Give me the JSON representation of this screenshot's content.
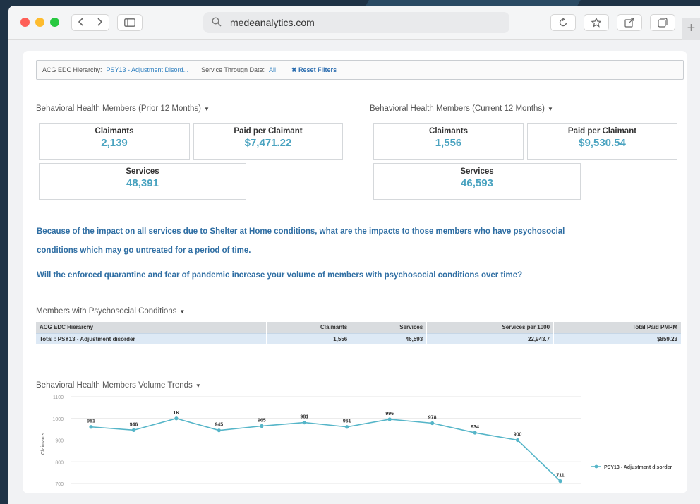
{
  "browser": {
    "url": "medeanalytics.com"
  },
  "filters": {
    "hierarchy_label": "ACG EDC Hierarchy:",
    "hierarchy_value": "PSY13 - Adjustment Disord...",
    "date_label": "Service Througn Date:",
    "date_value": "All",
    "reset_label": "Reset Filters"
  },
  "prior": {
    "title": "Behavioral Health Members (Prior 12 Months)",
    "claimants_label": "Claimants",
    "claimants_value": "2,139",
    "paid_label": "Paid per Claimant",
    "paid_value": "$7,471.22",
    "services_label": "Services",
    "services_value": "48,391"
  },
  "current": {
    "title": "Behavioral Health Members (Current 12 Months)",
    "claimants_label": "Claimants",
    "claimants_value": "1,556",
    "paid_label": "Paid per Claimant",
    "paid_value": "$9,530.54",
    "services_label": "Services",
    "services_value": "46,593"
  },
  "questions": {
    "q1_line1": "Because of the impact on all services due to Shelter at Home conditions, what are the impacts to those members who have psychosocial",
    "q1_line2": "conditions which may go untreated for a period of time.",
    "q2": "Will the enforced quarantine and fear of pandemic increase your volume of members with psychosocial conditions over time?"
  },
  "table": {
    "title": "Members with Psychosocial Conditions",
    "headers": [
      "ACG EDC Hierarchy",
      "Claimants",
      "Services",
      "Services per 1000",
      "Total Paid PMPM"
    ],
    "row": [
      "Total : PSY13 - Adjustment disorder",
      "1,556",
      "46,593",
      "22,943.7",
      "$859.23"
    ]
  },
  "chart_title": "Behavioral Health Members Volume Trends",
  "colors": {
    "accent": "#4aa3c0",
    "link": "#2f6ea3",
    "line": "#55b5c8"
  },
  "chart_data": {
    "type": "line",
    "ylabel": "Claimants",
    "ylim": [
      700,
      1100
    ],
    "yticks": [
      1100,
      1000,
      900,
      800,
      700
    ],
    "series": [
      {
        "name": "PSY13 - Adjustment disorder",
        "values": [
          961,
          946,
          1000,
          945,
          965,
          981,
          961,
          996,
          978,
          934,
          900,
          711
        ],
        "labels": [
          "961",
          "946",
          "1K",
          "945",
          "965",
          "981",
          "961",
          "996",
          "978",
          "934",
          "900",
          "711"
        ]
      }
    ],
    "grid": true,
    "legend": "right"
  }
}
